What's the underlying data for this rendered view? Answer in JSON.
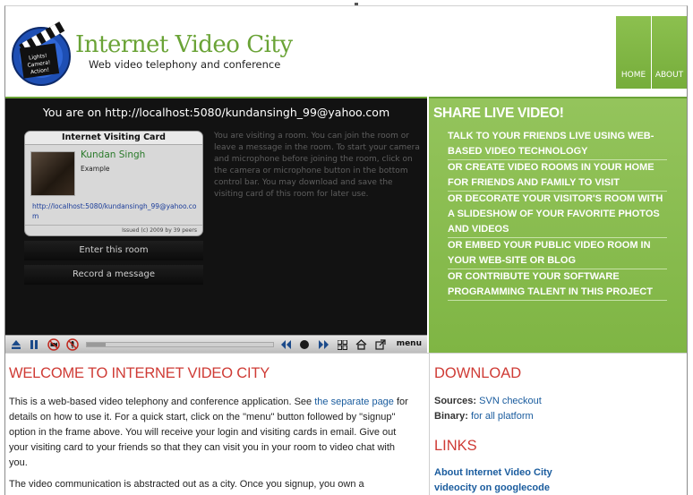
{
  "header": {
    "title": "Internet Video City",
    "subtitle": "Web video telephony and conference",
    "logo_text": "Lights! Camera! Action!",
    "nav": [
      {
        "label": "HOME"
      },
      {
        "label": "ABOUT"
      }
    ]
  },
  "video": {
    "url_line": "You are on http://localhost:5080/kundansingh_99@yahoo.com",
    "card": {
      "title": "Internet Visiting Card",
      "name": "Kundan Singh",
      "example": "Example",
      "link": "http://localhost:5080/kundansingh_99@yahoo.com",
      "footer": "Issued (c) 2009 by 39 peers"
    },
    "enter_label": "Enter this room",
    "record_label": "Record a message",
    "description": "You are visiting a room. You can join the room or leave a message in the room. To start your camera and microphone before joining the room, click on the camera or microphone button in the bottom control bar. You may download and save the visiting card of this room for later use.",
    "control_bar": {
      "menu_label": "menu",
      "progress": 0.1,
      "icons": [
        "eject-icon",
        "pause-icon",
        "camera-off-icon",
        "microphone-off-icon",
        "rewind-icon",
        "record-icon",
        "fast-forward-icon",
        "grid-icon",
        "home-icon",
        "popout-icon"
      ]
    }
  },
  "share": {
    "title": "SHARE LIVE VIDEO!",
    "items": [
      "TALK TO YOUR FRIENDS LIVE USING WEB-BASED VIDEO TECHNOLOGY",
      "OR CREATE VIDEO ROOMS IN YOUR HOME FOR FRIENDS AND FAMILY TO VISIT",
      "OR DECORATE YOUR VISITOR'S ROOM WITH A SLIDESHOW OF YOUR FAVORITE PHOTOS AND VIDEOS",
      "OR EMBED YOUR PUBLIC VIDEO ROOM IN YOUR WEB-SITE OR BLOG",
      "OR CONTRIBUTE YOUR SOFTWARE PROGRAMMING TALENT IN THIS PROJECT"
    ]
  },
  "main": {
    "welcome_title": "WELCOME TO INTERNET VIDEO CITY",
    "p1_before": "This is a web-based video telephony and conference application. See ",
    "p1_link": "the separate page",
    "p1_after": " for details on how to use it. For a quick start, click on the \"menu\" button followed by \"signup\" option in the frame above. You will receive your login and visiting cards in email. Give out your visiting card to your friends so that they can visit you in your room to video chat with you.",
    "p2": "The video communication is abstracted out as a city. Once you signup, you own a"
  },
  "sidebar": {
    "download_title": "DOWNLOAD",
    "sources_label": "Sources:",
    "sources_link": "SVN checkout",
    "binary_label": "Binary:",
    "binary_link": "for all platform",
    "links_title": "LINKS",
    "links": [
      "About Internet Video City",
      "videocity on googlecode"
    ]
  },
  "colors": {
    "brand_green": "#6aa336",
    "heading_red": "#cf3b35",
    "link_blue": "#1a5c9e"
  }
}
